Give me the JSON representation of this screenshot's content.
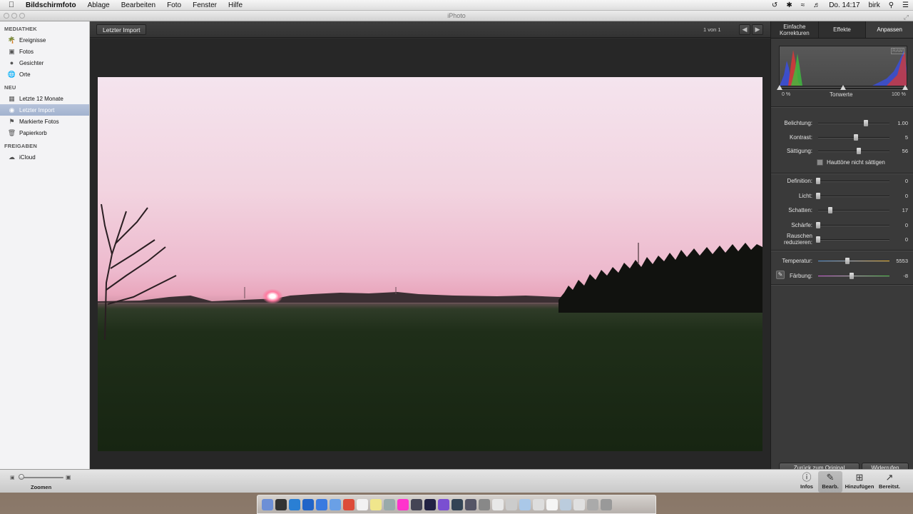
{
  "menubar": {
    "app_name": "Bildschirmfoto",
    "menus": [
      "Ablage",
      "Bearbeiten",
      "Foto",
      "Fenster",
      "Hilfe"
    ],
    "clock": "Do. 14:17",
    "user": "birk"
  },
  "window": {
    "title": "iPhoto"
  },
  "sidebar": {
    "sections": [
      {
        "header": "MEDIATHEK",
        "items": [
          {
            "label": "Ereignisse",
            "icon": "events-icon"
          },
          {
            "label": "Fotos",
            "icon": "photos-icon"
          },
          {
            "label": "Gesichter",
            "icon": "faces-icon"
          },
          {
            "label": "Orte",
            "icon": "places-icon"
          }
        ]
      },
      {
        "header": "NEU",
        "items": [
          {
            "label": "Letzte 12 Monate",
            "icon": "calendar-icon"
          },
          {
            "label": "Letzter Import",
            "icon": "import-icon",
            "selected": true
          },
          {
            "label": "Markierte Fotos",
            "icon": "flag-icon"
          },
          {
            "label": "Papierkorb",
            "icon": "trash-icon"
          }
        ]
      },
      {
        "header": "FREIGABEN",
        "items": [
          {
            "label": "iCloud",
            "icon": "cloud-icon"
          }
        ]
      }
    ]
  },
  "content": {
    "breadcrumb": "Letzter Import",
    "counter": "1 von 1"
  },
  "panel": {
    "tabs": [
      "Einfache Korrekturen",
      "Effekte",
      "Anpassen"
    ],
    "active_tab": "Anpassen",
    "histogram": {
      "badge": "RAW",
      "low": "0 %",
      "label": "Tonwerte",
      "high": "100 %"
    },
    "adjustments": [
      {
        "label": "Belichtung:",
        "value": "1.00",
        "pos": 0.67
      },
      {
        "label": "Kontrast:",
        "value": "5",
        "pos": 0.53
      },
      {
        "label": "Sättigung:",
        "value": "56",
        "pos": 0.57
      }
    ],
    "skin_tone_label": "Hauttöne nicht sättigen",
    "details": [
      {
        "label": "Definition:",
        "value": "0",
        "pos": 0.0
      },
      {
        "label": "Licht:",
        "value": "0",
        "pos": 0.0
      },
      {
        "label": "Schatten:",
        "value": "17",
        "pos": 0.17
      },
      {
        "label": "Schärfe:",
        "value": "0",
        "pos": 0.0
      },
      {
        "label": "Rauschen reduzieren:",
        "value": "0",
        "pos": 0.0
      }
    ],
    "color": [
      {
        "label": "Temperatur:",
        "value": "5553",
        "pos": 0.41
      },
      {
        "label": "Färbung:",
        "value": "-8",
        "pos": 0.47
      }
    ],
    "revert_label": "Zurück zum Original",
    "undo_label": "Widerrufen"
  },
  "bottombar": {
    "zoom_label": "Zoomen",
    "buttons": [
      {
        "label": "Infos",
        "icon": "info-icon"
      },
      {
        "label": "Bearb.",
        "icon": "pencil-icon",
        "active": true
      },
      {
        "label": "Hinzufügen",
        "icon": "plus-icon"
      },
      {
        "label": "Bereitst.",
        "icon": "share-icon"
      }
    ]
  },
  "colors": {
    "selection": "#a2b3cf",
    "panel_bg": "#3a3a3a",
    "content_bg": "#2e2e2e"
  }
}
